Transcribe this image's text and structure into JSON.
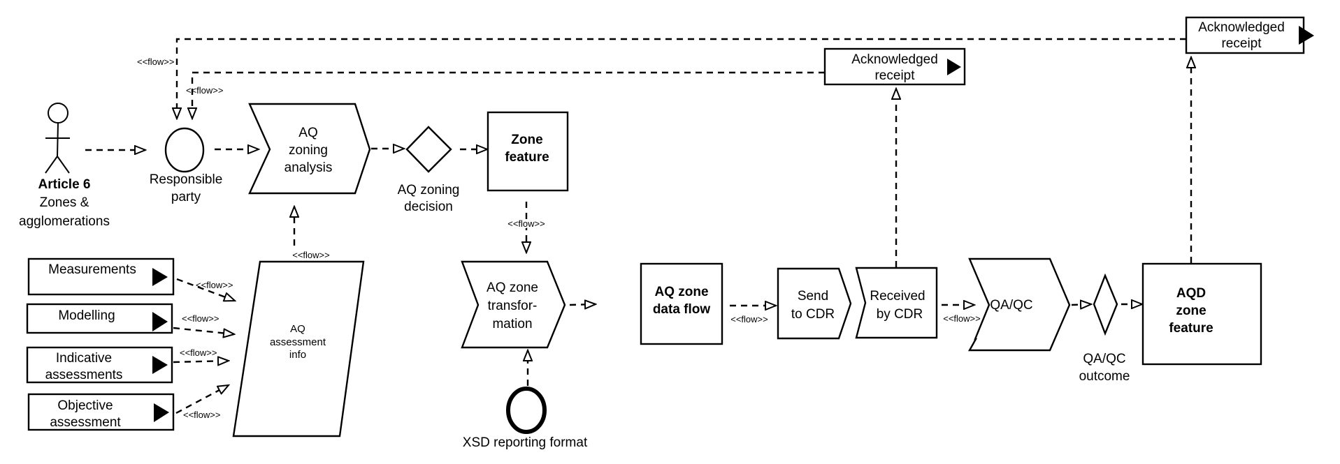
{
  "diagram": {
    "flow_label": "<<flow>>",
    "nodes": {
      "actor": {
        "title": "Article 6",
        "lines": [
          "Zones &",
          "agglomerations"
        ]
      },
      "responsible_party": {
        "lines": [
          "Responsible",
          "party"
        ]
      },
      "zoning_analysis": {
        "lines": [
          "AQ",
          "zoning",
          "analysis"
        ]
      },
      "zoning_decision": {
        "lines": [
          "AQ zoning",
          "decision"
        ]
      },
      "zone_feature": {
        "lines": [
          "Zone",
          "feature"
        ]
      },
      "assessment_info": {
        "lines": [
          "AQ",
          "assessment",
          "info"
        ]
      },
      "inputs": [
        {
          "lines": [
            "Measurements"
          ]
        },
        {
          "lines": [
            "Modelling"
          ]
        },
        {
          "lines": [
            "Indicative",
            "assessments"
          ]
        },
        {
          "lines": [
            "Objective",
            "assessment"
          ]
        }
      ],
      "zone_transformation": {
        "lines": [
          "AQ zone",
          "transfor-",
          "mation"
        ]
      },
      "xsd_format": {
        "label": "XSD reporting format"
      },
      "zone_data_flow": {
        "lines": [
          "AQ zone",
          "data flow"
        ]
      },
      "send_cdr": {
        "lines": [
          "Send",
          "to CDR"
        ]
      },
      "received_cdr": {
        "lines": [
          "Received",
          "by CDR"
        ]
      },
      "qaqc": {
        "label": "QA/QC"
      },
      "qaqc_outcome": {
        "lines": [
          "QA/QC",
          "outcome"
        ]
      },
      "aqd_zone_feature": {
        "lines": [
          "AQD",
          "zone",
          "feature"
        ]
      },
      "ack_receipt_1": {
        "lines": [
          "Acknowledged",
          "receipt"
        ]
      },
      "ack_receipt_2": {
        "lines": [
          "Acknowledged",
          "receipt"
        ]
      }
    }
  }
}
